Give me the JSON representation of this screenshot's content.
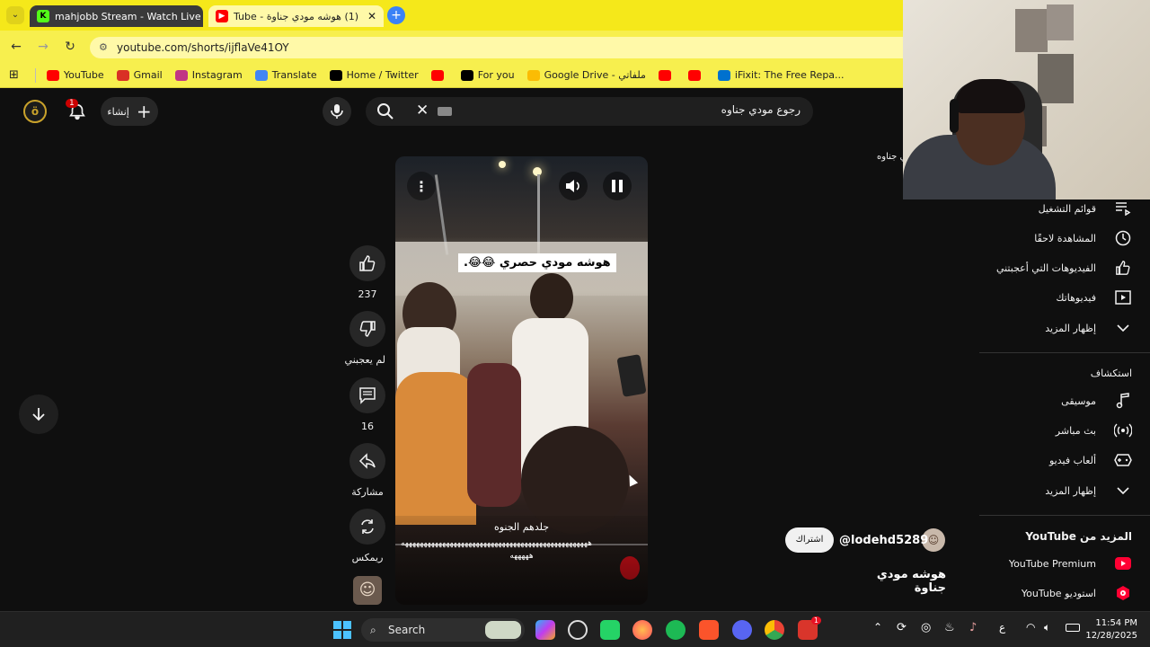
{
  "browser": {
    "tabs": [
      {
        "title": "mahjobb Stream - Watch Live o"
      },
      {
        "title": "(1) هوشه مودي جناوة - Tube"
      }
    ],
    "url": "youtube.com/shorts/ijflaVe41OY",
    "bookmarks": [
      {
        "label": "YouTube",
        "color": "#ff0000"
      },
      {
        "label": "Gmail",
        "color": "#d93025"
      },
      {
        "label": "Instagram",
        "color": "#c13584"
      },
      {
        "label": "Translate",
        "color": "#4285f4"
      },
      {
        "label": "Home / Twitter",
        "color": "#000000"
      },
      {
        "label": "",
        "color": "#ff0000"
      },
      {
        "label": "For you",
        "color": "#000000"
      },
      {
        "label": "Google Drive - ملفاتي",
        "color": "#fbbc04"
      },
      {
        "label": "",
        "color": "#ff0000"
      },
      {
        "label": "",
        "color": "#ff0000"
      },
      {
        "label": "iFixit: The Free Repa...",
        "color": "#0071ce"
      }
    ]
  },
  "masthead": {
    "create_label": "إنشاء",
    "notif_count": "1",
    "search_query": "رجوع مودي جناوه"
  },
  "video": {
    "overlay_title": "هوشه مودي حصري 😂😂.",
    "caption_line1": "جلدهم الجنوه",
    "caption_line2": "ههههههههههههههههههههههههههههههههههههههههههههههههههه",
    "caption_line3": "هههههه",
    "channel_handle": "@lodehd5289",
    "subscribe_label": "اشتراك",
    "title": "هوشه مودي جناوة"
  },
  "actions": {
    "likes": "237",
    "dislike_label": "لم يعجبني",
    "comments": "16",
    "share_label": "مشاركة",
    "remix_label": "ريمكس"
  },
  "sidebar": {
    "partial_label": "ي جناوه",
    "you_items": [
      {
        "label": "قوائم التشغيل"
      },
      {
        "label": "المشاهدة لاحقًا"
      },
      {
        "label": "الفيديوهات التي أعجبتني"
      },
      {
        "label": "فيديوهاتك"
      },
      {
        "label": "إظهار المزيد"
      }
    ],
    "explore_heading": "استكشاف",
    "explore_items": [
      {
        "label": "موسيقى"
      },
      {
        "label": "بث مباشر"
      },
      {
        "label": "ألعاب فيديو"
      },
      {
        "label": "إظهار المزيد"
      }
    ],
    "more_heading": "المزيد من YouTube",
    "more_items": [
      {
        "label": "YouTube Premium"
      },
      {
        "label": "استوديو YouTube"
      }
    ]
  },
  "taskbar": {
    "search_label": "Search",
    "lang": "ع",
    "time": "11:54 PM",
    "date": "12/28/2025",
    "badge": "1"
  }
}
